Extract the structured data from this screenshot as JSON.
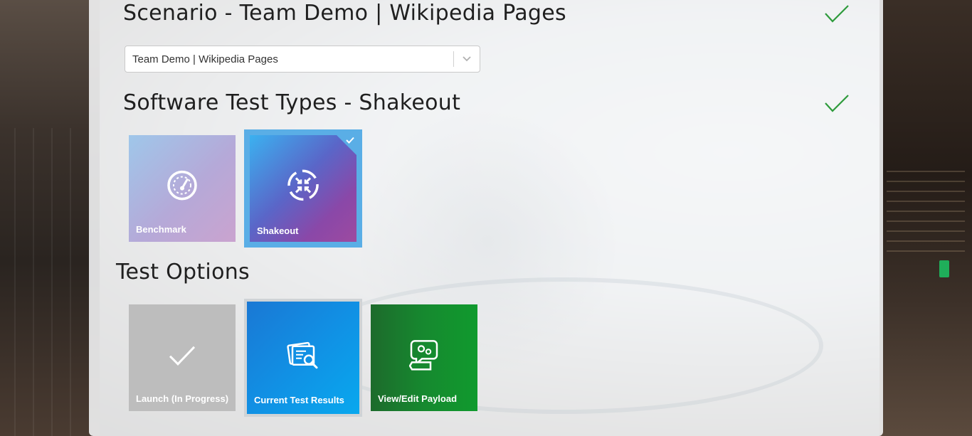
{
  "scenario": {
    "title": "Scenario - Team Demo | Wikipedia Pages",
    "select_value": "Team Demo | Wikipedia Pages",
    "complete_icon": "check-icon"
  },
  "test_types": {
    "title": "Software Test Types - Shakeout",
    "complete_icon": "check-icon",
    "tiles": [
      {
        "label": "Benchmark",
        "icon": "speedometer-icon",
        "selected": false
      },
      {
        "label": "Shakeout",
        "icon": "arrows-collapse-icon",
        "selected": true
      }
    ]
  },
  "test_options": {
    "title": "Test Options",
    "tiles": [
      {
        "label": "Launch (In Progress)",
        "icon": "check-icon"
      },
      {
        "label": "Current Test Results",
        "icon": "document-search-icon"
      },
      {
        "label": "View/Edit Payload",
        "icon": "settings-chat-icon"
      }
    ]
  },
  "colors": {
    "check_green": "#2e9b3c",
    "selected_border": "#5aaee6",
    "results_blue": "#1190e4",
    "payload_green": "#16892f"
  }
}
